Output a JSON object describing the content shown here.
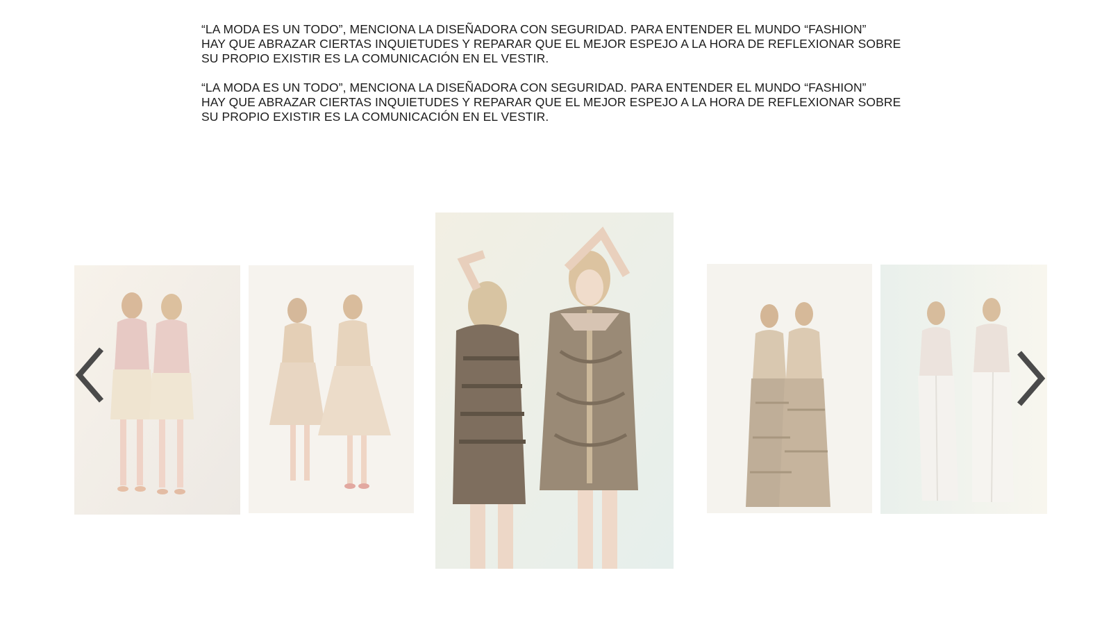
{
  "article": {
    "paragraphs": [
      "“LA MODA ES UN TODO”, MENCIONA LA DISEÑADORA CON SEGURIDAD. PARA ENTENDER EL MUNDO “FASHION”\nHAY QUE ABRAZAR CIERTAS INQUIETUDES Y REPARAR QUE EL MEJOR ESPEJO A LA HORA DE REFLEXIONAR SOBRE\nSU PROPIO EXISTIR ES LA COMUNICACIÓN EN EL VESTIR.",
      "“LA MODA ES UN TODO”, MENCIONA LA DISEÑADORA CON SEGURIDAD. PARA ENTENDER EL MUNDO “FASHION”\nHAY QUE ABRAZAR CIERTAS INQUIETUDES Y REPARAR QUE EL MEJOR ESPEJO A LA HORA DE REFLEXIONAR SOBRE\nSU PROPIO EXISTIR ES LA COMUNICACIÓN EN EL VESTIR."
    ]
  },
  "gallery": {
    "prev_icon": "chevron-left-icon",
    "next_icon": "chevron-right-icon",
    "arrow_color": "#4a4a4a",
    "images": [
      {
        "name": "gallery-image-1",
        "description_color": "#e8d4c8"
      },
      {
        "name": "gallery-image-2",
        "description_color": "#e3cdb8"
      },
      {
        "name": "gallery-image-3-featured",
        "description_color": "#9a8b78"
      },
      {
        "name": "gallery-image-4",
        "description_color": "#c8b7a3"
      },
      {
        "name": "gallery-image-5",
        "description_color": "#ece7e2"
      }
    ]
  }
}
